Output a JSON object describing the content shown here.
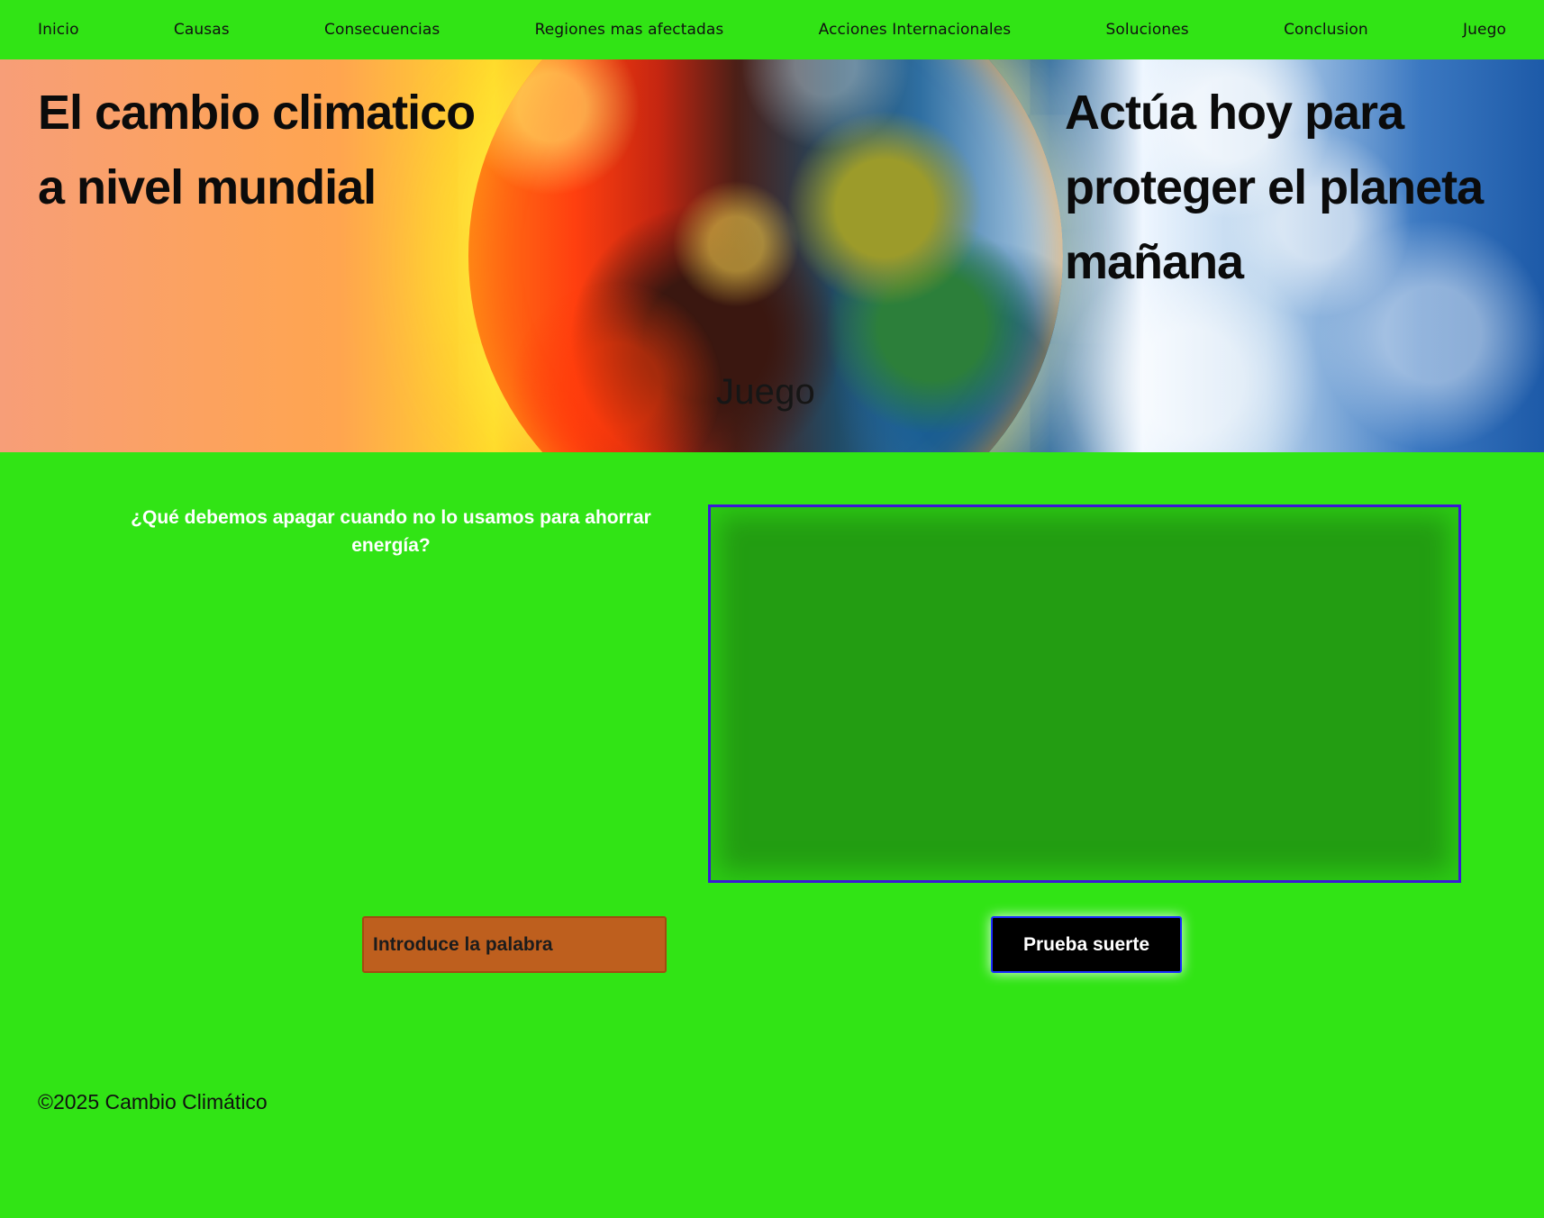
{
  "nav": {
    "items": [
      {
        "label": "Inicio"
      },
      {
        "label": "Causas"
      },
      {
        "label": "Consecuencias"
      },
      {
        "label": "Regiones mas afectadas"
      },
      {
        "label": "Acciones Internacionales"
      },
      {
        "label": "Soluciones"
      },
      {
        "label": "Conclusion"
      },
      {
        "label": "Juego"
      }
    ]
  },
  "hero": {
    "left_title": "El cambio climatico a nivel mundial",
    "right_title": "Actúa hoy para proteger el planeta mañana",
    "section_title": "Juego"
  },
  "game": {
    "question": "¿Qué debemos apagar cuando no lo usamos para ahorrar energía?",
    "input_placeholder": "Introduce la palabra",
    "button_label": "Prueba suerte"
  },
  "footer": {
    "copyright": "©2025 Cambio Climático"
  },
  "colors": {
    "background": "#31e415",
    "canvas_fill": "#239d12",
    "canvas_border": "#3a18d8",
    "input_bg": "#be5f1e",
    "button_bg": "#000000"
  }
}
